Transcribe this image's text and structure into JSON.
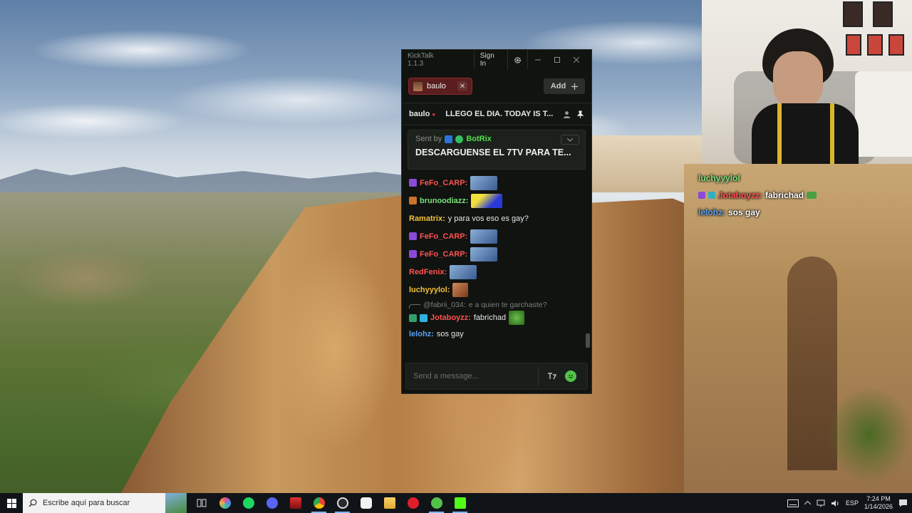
{
  "kicktalk": {
    "app_title": "KickTalk 1.1.3",
    "signin_label": "Sign In",
    "tab_name": "baulo",
    "add_label": "Add",
    "streamer": "baulo",
    "stream_title": "LLEGO EL DIA. TODAY IS T...",
    "pinned": {
      "sent_by": "Sent by",
      "author": "BotRix",
      "text": "DESCARGUENSE EL 7TV PARA TE..."
    },
    "messages": [
      {
        "user": "FeFo_CARP:",
        "text": "",
        "color": "#ff5252",
        "badge": "#8a4bd8",
        "emote": "#4a6ea8"
      },
      {
        "user": "brunoodiazz:",
        "text": "",
        "color": "#7be07b",
        "badge": "#c9742a",
        "emote": "#2a3ad8"
      },
      {
        "user": "Ramatrix:",
        "text": "y para vos eso es gay?",
        "color": "#f2c23a",
        "badge": "",
        "emote": ""
      },
      {
        "user": "FeFo_CARP:",
        "text": "",
        "color": "#ff5252",
        "badge": "#8a4bd8",
        "emote": "#4a6ea8"
      },
      {
        "user": "FeFo_CARP:",
        "text": "",
        "color": "#ff5252",
        "badge": "#8a4bd8",
        "emote": "#4a6ea8"
      },
      {
        "user": "RedFenix:",
        "text": "",
        "color": "#ff5252",
        "badge": "",
        "emote": "#4a6ea8"
      },
      {
        "user": "luchyyylol:",
        "text": "",
        "color": "#f2c23a",
        "badge": "",
        "emote": "#a0502a"
      }
    ],
    "reply": {
      "to": "@fabrii_034:",
      "text": "e a quien te garchaste?"
    },
    "reply_message": {
      "user": "Jotaboyzz:",
      "text": "fabrichad",
      "color": "#ff5252"
    },
    "last_message": {
      "user": "lelohz:",
      "text": "sos gay",
      "color": "#5aa0f0"
    },
    "input_placeholder": "Send a message..."
  },
  "overlay_chat": [
    {
      "user": "luchyyylol",
      "text": "",
      "color": "#7be07b"
    },
    {
      "user": "Jotaboyzz:",
      "text": "fabrichad",
      "color": "#ff5252"
    },
    {
      "user": "lelohz:",
      "text": "sos gay",
      "color": "#5aa0f0"
    }
  ],
  "taskbar": {
    "search_placeholder": "Escribe aquí para buscar",
    "language": "ESP",
    "time": "7:24 PM",
    "date": "1/14/2026"
  }
}
